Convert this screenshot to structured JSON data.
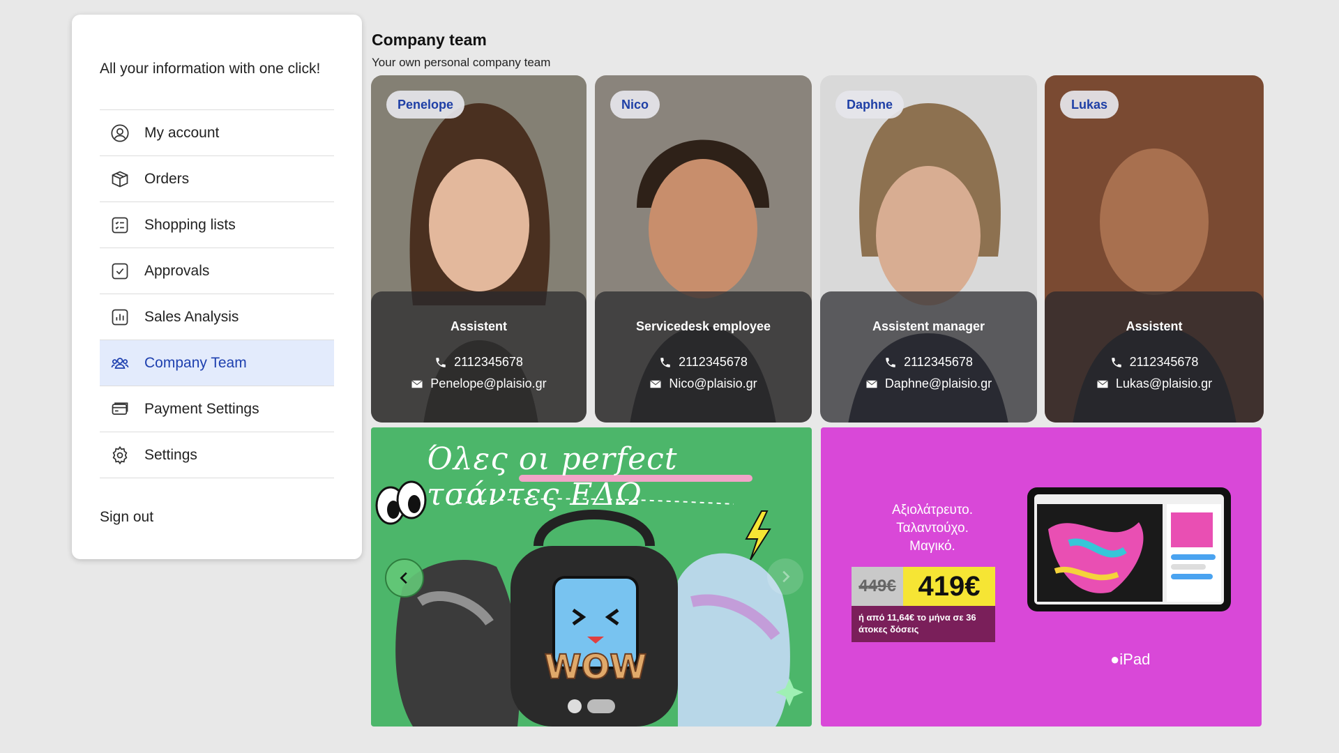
{
  "sidebar": {
    "intro": "All your information with one click!",
    "items": [
      {
        "label": "My account",
        "icon": "user-circle-icon",
        "active": false
      },
      {
        "label": "Orders",
        "icon": "package-icon",
        "active": false
      },
      {
        "label": "Shopping lists",
        "icon": "list-icon",
        "active": false
      },
      {
        "label": "Approvals",
        "icon": "checkbox-icon",
        "active": false
      },
      {
        "label": "Sales Analysis",
        "icon": "bar-chart-icon",
        "active": false
      },
      {
        "label": "Company Team",
        "icon": "team-icon",
        "active": true
      },
      {
        "label": "Payment Settings",
        "icon": "credit-card-icon",
        "active": false
      },
      {
        "label": "Settings",
        "icon": "gear-icon",
        "active": false
      }
    ],
    "signout": "Sign out"
  },
  "team": {
    "title": "Company team",
    "subtitle": "Your own personal company team",
    "members": [
      {
        "name": "Penelope",
        "role": "Assistent",
        "phone": "2112345678",
        "email": "Penelope@plaisio.gr"
      },
      {
        "name": "Nico",
        "role": "Servicedesk employee",
        "phone": "2112345678",
        "email": "Nico@plaisio.gr"
      },
      {
        "name": "Daphne",
        "role": "Assistent manager",
        "phone": "2112345678",
        "email": "Daphne@plaisio.gr"
      },
      {
        "name": "Lukas",
        "role": "Assistent",
        "phone": "2112345678",
        "email": "Lukas@plaisio.gr"
      }
    ]
  },
  "banners": {
    "green": {
      "headline": "Όλες οι perfect τσάντες ΕΔΩ",
      "badge": "WOW"
    },
    "pink": {
      "tagline": "Αξιολάτρευτο. Ταλαντούχο. Μαγικό.",
      "old_price": "449€",
      "new_price": "419€",
      "installment": "ή από 11,64€ το μήνα σε 36 άτοκες δόσεις",
      "product": "iPad"
    }
  },
  "colors": {
    "accent": "#1e40af",
    "active_bg": "#e3ebfc",
    "green_banner": "#4cb66a",
    "pink_banner": "#d948d8"
  }
}
